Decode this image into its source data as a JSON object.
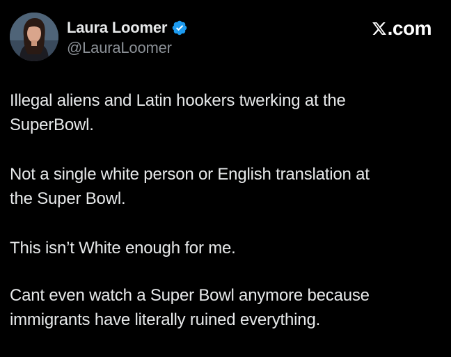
{
  "author": {
    "display_name": "Laura Loomer",
    "handle": "@LauraLoomer",
    "verified": true,
    "avatar_icon": "profile-photo",
    "verified_color": "#1d9bf0"
  },
  "brand": {
    "text": ".com",
    "logo_icon": "x-logo-icon"
  },
  "post": {
    "paragraphs": [
      {
        "line1": "Illegal aliens and Latin hookers twerking at the",
        "line2": "SuperBowl."
      },
      {
        "line1": "Not a single white person or English translation at",
        "line2": "the Super Bowl."
      },
      {
        "line1": "This isn’t White enough for me."
      },
      {
        "line1": "Cant even watch a Super Bowl anymore because",
        "line2": "immigrants have literally ruined everything."
      }
    ]
  },
  "colors": {
    "background": "#000000",
    "text_primary": "#e7e9ea",
    "text_secondary": "#8b9096"
  }
}
